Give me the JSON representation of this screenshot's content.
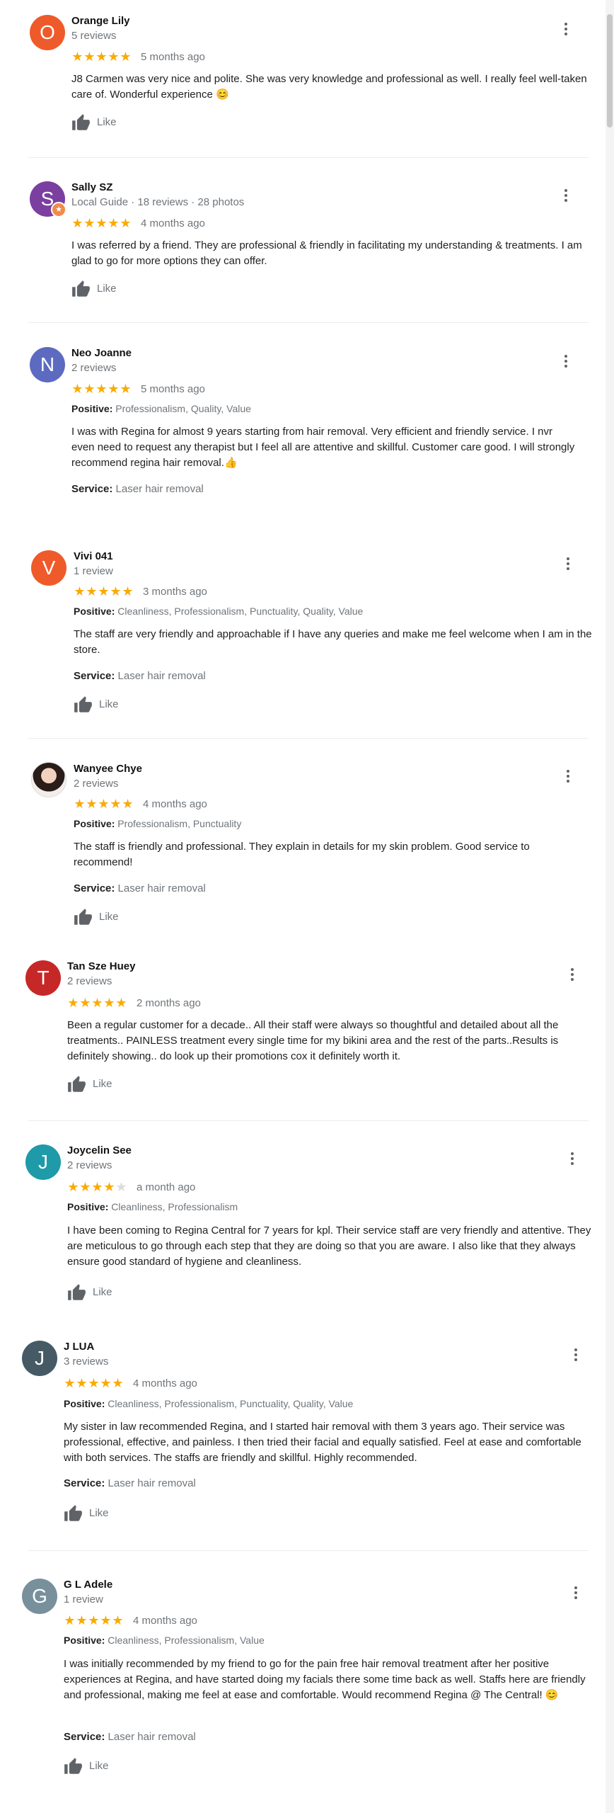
{
  "like_label": "Like",
  "service_label": "Service:",
  "positive_label": "Positive:",
  "reviews": [
    {
      "name": "Orange Lily",
      "meta": "5 reviews",
      "avatar_letter": "O",
      "avatar_color": "#ef5a2a",
      "stars": 5,
      "date": "5 months ago",
      "text": "J8 Carmen was very nice and polite. She was very knowledge and professional as well. I really feel well-taken care of. Wonderful experience",
      "emoji": "😊"
    },
    {
      "name": "Sally SZ",
      "meta": "Local Guide · 18 reviews · 28 photos",
      "avatar_letter": "S",
      "avatar_color": "#7b3fa0",
      "local_guide_badge": "★",
      "stars": 5,
      "date": "4 months ago",
      "text": "I was referred by a friend. They are professional & friendly in facilitating my understanding & treatments. I am glad to go for more options they can offer."
    },
    {
      "name": "Neo Joanne",
      "meta": "2 reviews",
      "avatar_letter": "N",
      "avatar_color": "#5c6bc0",
      "stars": 5,
      "date": "5 months ago",
      "positive": "Professionalism, Quality, Value",
      "text": "I was with Regina for almost 9 years starting from hair removal. Very efficient and friendly service. I nvr even need to request any therapist but I feel all are attentive and skillful. Customer care good. I will strongly recommend regina hair removal.",
      "emoji": "👍",
      "service": "Laser hair removal"
    },
    {
      "name": "Vivi 041",
      "meta": "1 review",
      "avatar_letter": "V",
      "avatar_color": "#ef5a2a",
      "stars": 5,
      "date": "3 months ago",
      "positive": "Cleanliness, Professionalism, Punctuality, Quality, Value",
      "text": "The staff are very friendly and approachable if I have any queries and make me feel welcome when I am in the store.",
      "service": "Laser hair removal"
    },
    {
      "name": "Wanyee Chye",
      "meta": "2 reviews",
      "avatar_letter": "",
      "avatar_color": "#e8d4c8",
      "stars": 5,
      "date": "4 months ago",
      "positive": "Professionalism, Punctuality",
      "text": "The staff is friendly and professional. They explain in details for my skin problem. Good service to recommend!",
      "service": "Laser hair removal"
    },
    {
      "name": "Tan Sze Huey",
      "meta": "2 reviews",
      "avatar_letter": "T",
      "avatar_color": "#c62828",
      "stars": 5,
      "date": "2 months ago",
      "text": "Been a regular customer for a decade.. All their staff were always so thoughtful and detailed about all the treatments.. PAINLESS treatment every single time for my bikini area and the rest of the parts..Results is definitely showing.. do look up their promotions cox it definitely worth it."
    },
    {
      "name": "Joycelin See",
      "meta": "2 reviews",
      "avatar_letter": "J",
      "avatar_color": "#1e9aa8",
      "stars": 4,
      "date": "a month ago",
      "positive": "Cleanliness, Professionalism",
      "text": "I have been coming to Regina Central for 7 years for kpl. Their service staff are very friendly and attentive. They are meticulous to go through each step that they are doing so that you are aware. I also like that they always ensure good standard of hygiene and cleanliness."
    },
    {
      "name": "J LUA",
      "meta": "3 reviews",
      "avatar_letter": "J",
      "avatar_color": "#455a64",
      "stars": 5,
      "date": "4 months ago",
      "positive": "Cleanliness, Professionalism, Punctuality, Quality, Value",
      "text": "My sister in law recommended Regina, and I started hair removal with them 3 years ago. Their service was professional, effective, and painless. I then tried their facial and equally satisfied. Feel at ease and comfortable with both services. The staffs are friendly and skillful.  Highly recommended.",
      "service": "Laser hair removal"
    },
    {
      "name": "G L Adele",
      "meta": "1 review",
      "avatar_letter": "G",
      "avatar_color": "#78909c",
      "stars": 5,
      "date": "4 months ago",
      "positive": "Cleanliness, Professionalism, Value",
      "text": "I was initially recommended by my friend to go for the pain free hair removal treatment after her positive experiences at Regina, and have started doing my facials there some time back as well. Staffs here are friendly and professional, making me feel at ease and comfortable. Would recommend Regina @ The Central!",
      "emoji": "😊",
      "service": "Laser hair removal"
    }
  ]
}
